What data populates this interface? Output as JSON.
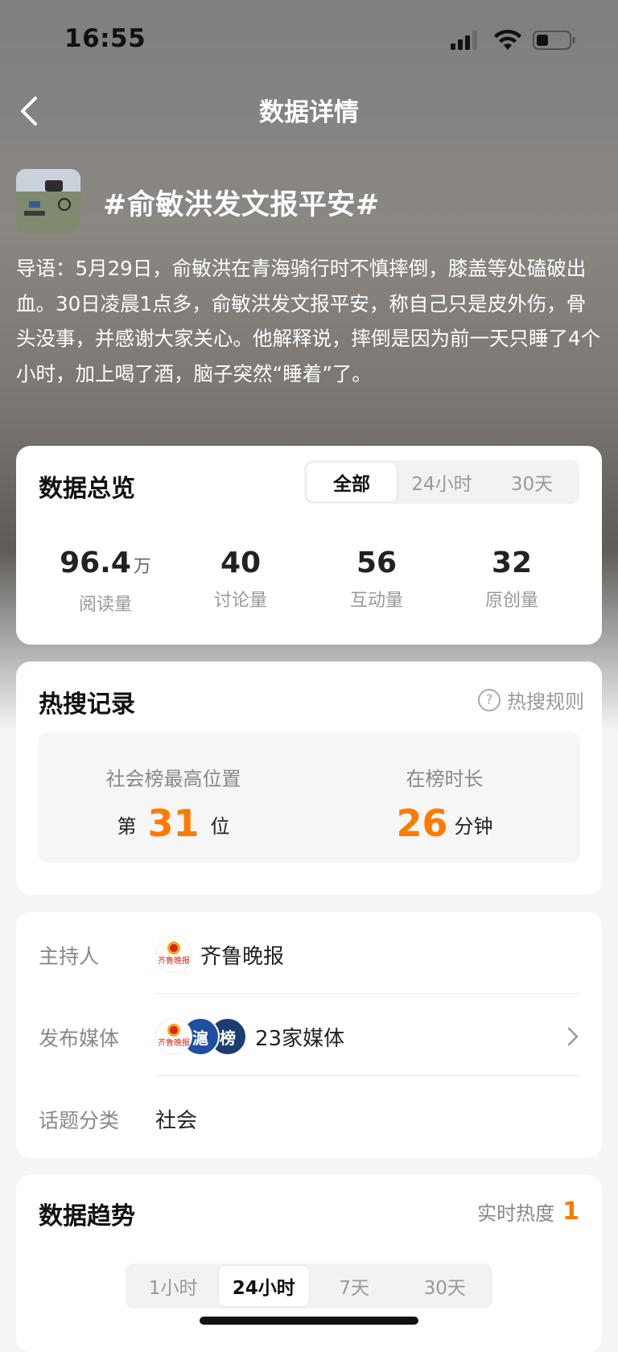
{
  "status_bar": {
    "time": "16:55"
  },
  "nav": {
    "title": "数据详情"
  },
  "topic": {
    "title": "#俞敏洪发文报平安#",
    "intro": "导语：5月29日，俞敏洪在青海骑行时不慎摔倒，膝盖等处磕破出血。30日凌晨1点多，俞敏洪发文报平安，称自己只是皮外伤，骨头没事，并感谢大家关心。他解释说，摔倒是因为前一天只睡了4个小时，加上喝了酒，脑子突然“睡着”了。"
  },
  "overview": {
    "title": "数据总览",
    "tabs": [
      "全部",
      "24小时",
      "30天"
    ],
    "active_tab": "全部",
    "stats": [
      {
        "value": "96.4",
        "unit": "万",
        "label": "阅读量"
      },
      {
        "value": "40",
        "unit": "",
        "label": "讨论量"
      },
      {
        "value": "56",
        "unit": "",
        "label": "互动量"
      },
      {
        "value": "32",
        "unit": "",
        "label": "原创量"
      }
    ]
  },
  "hot_search": {
    "title": "热搜记录",
    "rule_link": "热搜规则",
    "peak_label": "社会榜最高位置",
    "peak_prefix": "第",
    "peak_value": "31",
    "peak_suffix": "位",
    "duration_label": "在榜时长",
    "duration_value": "26",
    "duration_suffix": "分钟"
  },
  "info": {
    "host_label": "主持人",
    "host_name": "齐鲁晚报",
    "media_label": "发布媒体",
    "media_count": "23家媒体",
    "media_logos": [
      "齐鲁晚报",
      "滬",
      "榜"
    ],
    "category_label": "话题分类",
    "category_value": "社会"
  },
  "trend": {
    "title": "数据趋势",
    "heat_label": "实时热度",
    "heat_value": "1",
    "tabs": [
      "1小时",
      "24小时",
      "7天",
      "30天"
    ],
    "active_tab": "24小时"
  },
  "colors": {
    "accent": "#ff7a00"
  }
}
